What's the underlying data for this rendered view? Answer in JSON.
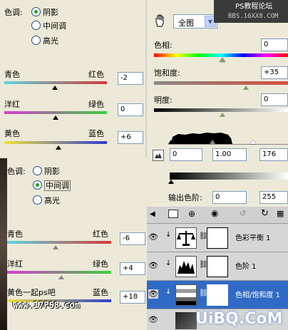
{
  "panel1": {
    "tone_label": "色调:",
    "radio_shadows": "阴影",
    "radio_midtones": "中间调",
    "radio_highlights": "高光",
    "cyan": "青色",
    "red": "红色",
    "magenta": "洋红",
    "green": "绿色",
    "yellow": "黄色",
    "blue": "蓝色",
    "value1": "-2",
    "value2": "0",
    "value3": "+6"
  },
  "panel2": {
    "tone_label": "色调:",
    "radio_shadows": "阴影",
    "radio_midtones": "中间调",
    "radio_highlights": "高光",
    "cyan": "青色",
    "red": "红色",
    "magenta": "洋红",
    "green": "绿色",
    "yellow": "黄色一起ps吧",
    "blue": "蓝色",
    "value1": "-6",
    "value2": "+4",
    "value3": "+18"
  },
  "hue_sat": {
    "edit_select": "全图",
    "hue_label": "色相:",
    "hue_value": "0",
    "sat_label": "饱和度:",
    "sat_value": "+35",
    "light_label": "明度:",
    "light_value": "0"
  },
  "levels": {
    "input_black": "0",
    "input_gamma": "1.00",
    "input_white": "176",
    "output_label": "输出色阶:",
    "output_black": "0",
    "output_white": "255"
  },
  "layers": [
    {
      "name": "色彩平衡 1"
    },
    {
      "name": "色阶 1"
    },
    {
      "name": "色相/饱和度 1"
    }
  ],
  "watermarks": {
    "top_right": "PS教程论坛",
    "top_right_url": "BBS.16XX8.COM",
    "bottom_left": "www.17PS8.com",
    "bottom_right": "UiBQ.CoM"
  },
  "colors": {
    "selected_layer": "#316ac5",
    "radio_dot": "#21a121"
  }
}
